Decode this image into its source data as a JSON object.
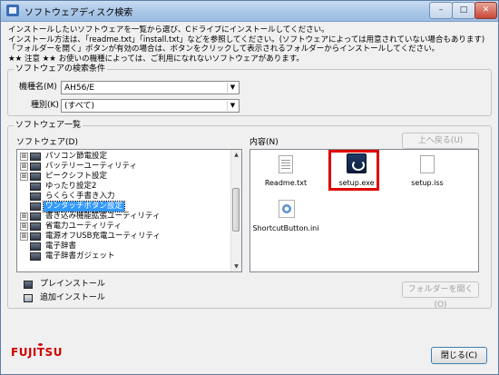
{
  "window": {
    "title": "ソフトウェアディスク検索",
    "minimize": "–",
    "maximize": "□",
    "close": "✕"
  },
  "intro": {
    "lines": [
      "インストールしたいソフトウェアを一覧から選び、Cドライブにインストールしてください。",
      "インストール方法は、「readme.txt」「install.txt」などを参照してください。(ソフトウェアによっては用意されていない場合もあります)",
      "「フォルダーを開く」ボタンが有効の場合は、ボタンをクリックして表示されるフォルダーからインストールしてください。",
      "★★ 注意 ★★ お使いの機種によっては、ご利用になれないソフトウェアがあります。"
    ]
  },
  "search": {
    "group_label": "ソフトウェアの検索条件",
    "model_label": "機種名(M)",
    "model_value": "AH56/E",
    "type_label": "種別(K)",
    "type_value": "(すべて)"
  },
  "list": {
    "group_label": "ソフトウェア一覧",
    "software_label": "ソフトウェア(D)",
    "content_label": "内容(N)",
    "back_button": "上へ戻る(U)",
    "open_folder_button": "フォルダーを開く(O)"
  },
  "tree": {
    "items": [
      {
        "label": "パソコン節電設定",
        "expander": "⊞",
        "selected": false
      },
      {
        "label": "バッテリーユーティリティ",
        "expander": "⊞",
        "selected": false
      },
      {
        "label": "ピークシフト設定",
        "expander": "⊞",
        "selected": false
      },
      {
        "label": "ゆったり設定2",
        "expander": "",
        "selected": false
      },
      {
        "label": "らくらく手書き入力",
        "expander": "",
        "selected": false
      },
      {
        "label": "ワンタッチボタン設定",
        "expander": "",
        "selected": true
      },
      {
        "label": "書き込み機能拡張ユーティリティ",
        "expander": "⊞",
        "selected": false
      },
      {
        "label": "省電力ユーティリティ",
        "expander": "⊞",
        "selected": false
      },
      {
        "label": "電源オフUSB充電ユーティリティ",
        "expander": "⊞",
        "selected": false
      },
      {
        "label": "電子辞書",
        "expander": "",
        "selected": false
      },
      {
        "label": "電子辞書ガジェット",
        "expander": "",
        "selected": false
      }
    ]
  },
  "files": [
    {
      "name": "Readme.txt",
      "icon": "text-file-icon"
    },
    {
      "name": "setup.exe",
      "icon": "setup-exe-icon"
    },
    {
      "name": "setup.iss",
      "icon": "blank-file-icon"
    },
    {
      "name": "ShortcutButton.ini",
      "icon": "ini-file-icon"
    }
  ],
  "legend": {
    "preinstall": "プレインストール",
    "add_install": "追加インストール"
  },
  "footer": {
    "logo": "FUJITSU",
    "close_button": "閉じる(C)"
  },
  "colors": {
    "selection": "#3399ff",
    "highlight": "#e00000",
    "brand": "#d00000"
  }
}
